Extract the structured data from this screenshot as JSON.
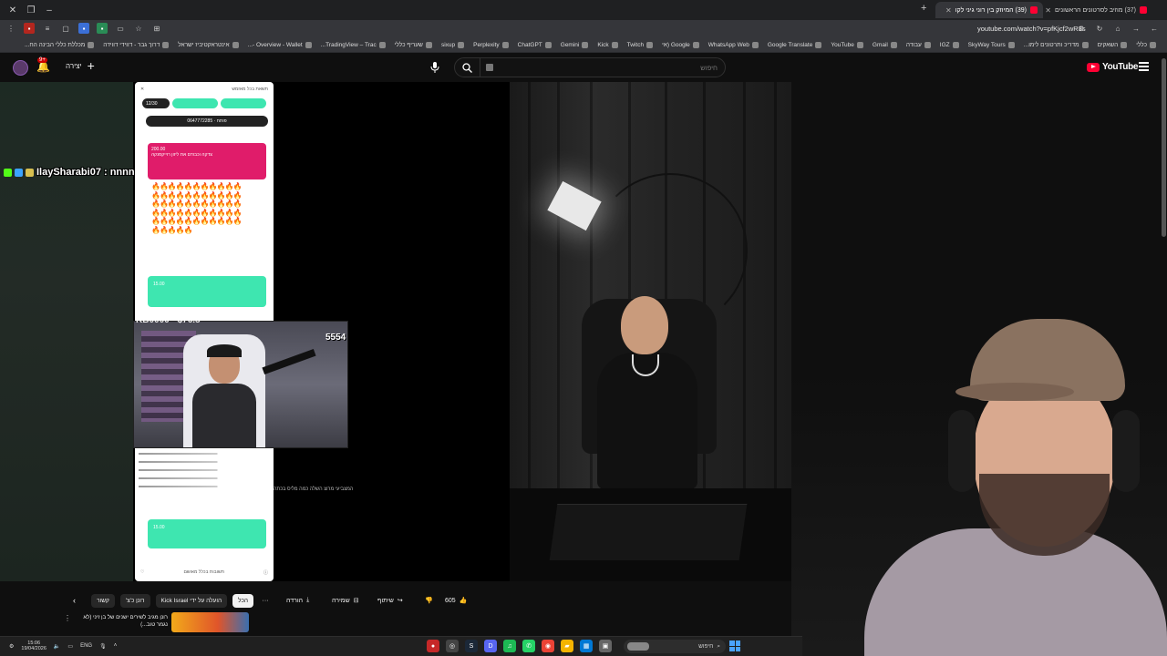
{
  "browser": {
    "tabs": [
      {
        "title": "(39) המיוזק בין רוני גיני לקו",
        "active": true
      },
      {
        "title": "(37) מוזיב לסרטונים הראשונים",
        "active": false
      }
    ],
    "url": "youtube.com/watch?v=pfKjcf2wR3s",
    "bookmarks": [
      "כללי",
      "השאקים",
      "מדריכ ותרטונים לימו...",
      "SkyWay Tours",
      "IGZ",
      "עבודה",
      "Gmail",
      "YouTube",
      "Google Translate",
      "WhatsApp Web",
      "Google (אי",
      "Twitch",
      "Kick",
      "Gemini",
      "ChatGPT",
      "Perplexity",
      "sixup",
      "שעריף כללי",
      "TradingView – Trac...",
      "Overview - Wallet -...",
      "אינטראקטיביז ישראל",
      "דרוך גבר - דווידי דווידה",
      "מכללת כללי הבינה הח..."
    ]
  },
  "youtube": {
    "create_label": "יצירה",
    "notif_count": "9+",
    "search_placeholder": "חיפוש",
    "logo_text": "YouTube",
    "logo_sup": "IL"
  },
  "stream": {
    "chat_user": "IlaySharabi07 : nnnn",
    "donation_label": "KB0000 - $76.5",
    "donation_count": "5554",
    "overlay_caption": "המצביעי מרוצ השלה כמה מליס בכתה"
  },
  "phone": {
    "header": "תשאת בכל מאזמש",
    "pill1": "12/30",
    "bar_text": "0647772285 · פותח",
    "pink_amount": "200.00",
    "pink_text": "צדקה וכבודם את ליזון רוייקסנקה",
    "fires": "🔥🔥🔥🔥🔥🔥🔥🔥🔥🔥🔥🔥🔥🔥🔥🔥🔥🔥🔥🔥🔥🔥🔥🔥🔥🔥🔥🔥🔥🔥🔥🔥🔥🔥🔥🔥🔥🔥🔥🔥🔥🔥🔥🔥🔥🔥🔥🔥🔥🔥🔥🔥🔥🔥🔥🔥🔥🔥🔥🔥",
    "green_amount": "15.00",
    "green_amount2": "15.00",
    "bottom_text": "תשובות בכלל מאושם"
  },
  "actions": {
    "like_count": "605",
    "share_label": "שיתוף",
    "save_label": "שמירה",
    "download_label": "הורדה"
  },
  "chips": [
    {
      "label": "הכל",
      "selected": true
    },
    {
      "label": "הועלה על ידי Kick Israel",
      "selected": false
    },
    {
      "label": "רונן כ'צ'",
      "selected": false
    },
    {
      "label": "קשור",
      "selected": false
    }
  ],
  "recommendation": {
    "title": "רונן מגיב לשירים ישנים של בן זיני (לא נגמר טוב...)"
  },
  "taskbar": {
    "time": "15:06",
    "date": "19/04/2026",
    "lang": "ENG",
    "search_label": "חיפוש"
  },
  "colors": {
    "yt_red": "#ff0033",
    "chat_green": "#3ee6b0",
    "donation_pink": "#e01c6a"
  }
}
